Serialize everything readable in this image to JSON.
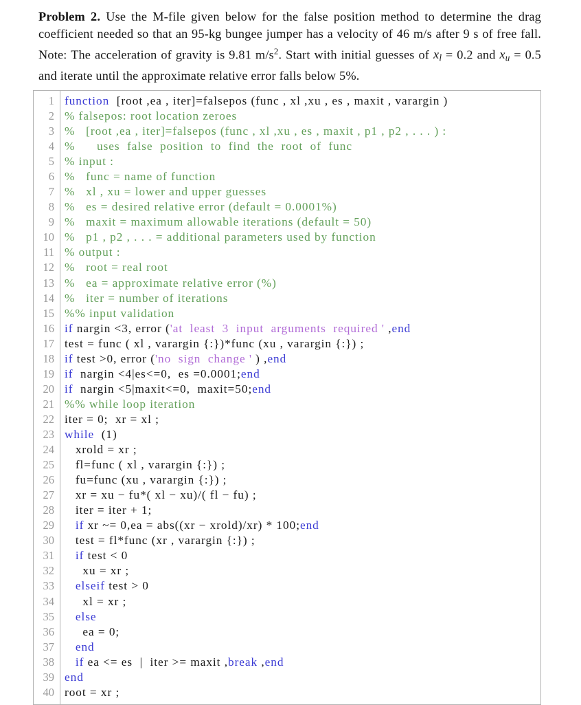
{
  "document": {
    "problem": {
      "label": "Problem 2.",
      "text_parts": {
        "p1": " Use the M-file given below for the false position method to determine the drag coefficient needed so that an 95-kg bungee jumper has a velocity of 46 m/s after 9 s of free fall. Note: The acceleration of gravity is 9.81 m/s",
        "sup1": "2",
        "p2": ". Start with initial guesses of ",
        "x_l": "x",
        "sub_l": "l",
        "p3": " = 0.2 and ",
        "x_u": "x",
        "sub_u": "u",
        "p4": " = 0.5 and iterate until the approximate relative error falls below 5%."
      },
      "plain_text": "Problem 2. Use the M-file given below for the false position method to determine the drag coefficient needed so that an 95-kg bungee jumper has a velocity of 46 m/s after 9 s of free fall. Note: The acceleration of gravity is 9.81 m/s^2. Start with initial guesses of x_l = 0.2 and x_u = 0.5 and iterate until the approximate relative error falls below 5%."
    },
    "colors": {
      "keyword": "#3b3bd4",
      "comment": "#63a05a",
      "string": "#b06ad6",
      "plain": "#1a1a1a",
      "lineno": "#9a9a9a",
      "border": "#b3b3b3",
      "background": "#ffffff"
    },
    "listing": {
      "language": "MATLAB",
      "first_line_number": 1,
      "total_lines": 40,
      "lines": [
        {
          "n": "1",
          "tokens": [
            {
              "t": "function",
              "c": "kw"
            },
            {
              "t": "  [root ,ea , iter]=falsepos (func , xl ,xu , es , maxit , varargin )",
              "c": "pl"
            }
          ]
        },
        {
          "n": "2",
          "tokens": [
            {
              "t": "% falsepos: root location zeroes",
              "c": "cm"
            }
          ]
        },
        {
          "n": "3",
          "tokens": [
            {
              "t": "%   [root ,ea , iter]=falsepos (func , xl ,xu , es , maxit , p1 , p2 , . . . ) :",
              "c": "cm"
            }
          ]
        },
        {
          "n": "4",
          "tokens": [
            {
              "t": "%      uses  false  position  to  find  the  root  of  func",
              "c": "cm"
            }
          ]
        },
        {
          "n": "5",
          "tokens": [
            {
              "t": "% input :",
              "c": "cm"
            }
          ]
        },
        {
          "n": "6",
          "tokens": [
            {
              "t": "%   func = name of function",
              "c": "cm"
            }
          ]
        },
        {
          "n": "7",
          "tokens": [
            {
              "t": "%   xl , xu = lower and upper guesses",
              "c": "cm"
            }
          ]
        },
        {
          "n": "8",
          "tokens": [
            {
              "t": "%   es = desired relative error (default = 0.0001%)",
              "c": "cm"
            }
          ]
        },
        {
          "n": "9",
          "tokens": [
            {
              "t": "%   maxit = maximum allowable iterations (default = 50)",
              "c": "cm"
            }
          ]
        },
        {
          "n": "10",
          "tokens": [
            {
              "t": "%   p1 , p2 , . . . = additional parameters used by function",
              "c": "cm"
            }
          ]
        },
        {
          "n": "11",
          "tokens": [
            {
              "t": "% output :",
              "c": "cm"
            }
          ]
        },
        {
          "n": "12",
          "tokens": [
            {
              "t": "%   root = real root",
              "c": "cm"
            }
          ]
        },
        {
          "n": "13",
          "tokens": [
            {
              "t": "%   ea = approximate relative error (%)",
              "c": "cm"
            }
          ]
        },
        {
          "n": "14",
          "tokens": [
            {
              "t": "%   iter = number of iterations",
              "c": "cm"
            }
          ]
        },
        {
          "n": "15",
          "tokens": [
            {
              "t": "%% input validation",
              "c": "cm"
            }
          ]
        },
        {
          "n": "16",
          "tokens": [
            {
              "t": "if",
              "c": "kw"
            },
            {
              "t": " nargin <3, error (",
              "c": "pl"
            },
            {
              "t": "'at  least  3  input  arguments  required '",
              "c": "str"
            },
            {
              "t": " ,",
              "c": "pl"
            },
            {
              "t": "end",
              "c": "kw"
            }
          ]
        },
        {
          "n": "17",
          "tokens": [
            {
              "t": "test = func ( xl , varargin {:})*func (xu , varargin {:}) ;",
              "c": "pl"
            }
          ]
        },
        {
          "n": "18",
          "tokens": [
            {
              "t": "if",
              "c": "kw"
            },
            {
              "t": " test >0, error (",
              "c": "pl"
            },
            {
              "t": "'no  sign  change '",
              "c": "str"
            },
            {
              "t": " ) ,",
              "c": "pl"
            },
            {
              "t": "end",
              "c": "kw"
            }
          ]
        },
        {
          "n": "19",
          "tokens": [
            {
              "t": "if",
              "c": "kw"
            },
            {
              "t": "  nargin <4|es<=0,  es =0.0001;",
              "c": "pl"
            },
            {
              "t": "end",
              "c": "kw"
            }
          ]
        },
        {
          "n": "20",
          "tokens": [
            {
              "t": "if",
              "c": "kw"
            },
            {
              "t": "  nargin <5|maxit<=0,  maxit=50;",
              "c": "pl"
            },
            {
              "t": "end",
              "c": "kw"
            }
          ]
        },
        {
          "n": "21",
          "tokens": [
            {
              "t": "%% while loop iteration",
              "c": "cm"
            }
          ]
        },
        {
          "n": "22",
          "tokens": [
            {
              "t": "iter = 0;  xr = xl ;",
              "c": "pl"
            }
          ]
        },
        {
          "n": "23",
          "tokens": [
            {
              "t": "while",
              "c": "kw"
            },
            {
              "t": "  (1)",
              "c": "pl"
            }
          ]
        },
        {
          "n": "24",
          "tokens": [
            {
              "t": "   xrold = xr ;",
              "c": "pl"
            }
          ]
        },
        {
          "n": "25",
          "tokens": [
            {
              "t": "   fl=func ( xl , varargin {:}) ;",
              "c": "pl"
            }
          ]
        },
        {
          "n": "26",
          "tokens": [
            {
              "t": "   fu=func (xu , varargin {:}) ;",
              "c": "pl"
            }
          ]
        },
        {
          "n": "27",
          "tokens": [
            {
              "t": "   xr = xu − fu*( xl − xu)/( fl − fu) ;",
              "c": "pl"
            }
          ]
        },
        {
          "n": "28",
          "tokens": [
            {
              "t": "   iter = iter + 1;",
              "c": "pl"
            }
          ]
        },
        {
          "n": "29",
          "tokens": [
            {
              "t": "   ",
              "c": "pl"
            },
            {
              "t": "if",
              "c": "kw"
            },
            {
              "t": " xr ~= 0,ea = abs((xr − xrold)/xr) * 100;",
              "c": "pl"
            },
            {
              "t": "end",
              "c": "kw"
            }
          ]
        },
        {
          "n": "30",
          "tokens": [
            {
              "t": "   test = fl*func (xr , varargin {:}) ;",
              "c": "pl"
            }
          ]
        },
        {
          "n": "31",
          "tokens": [
            {
              "t": "   ",
              "c": "pl"
            },
            {
              "t": "if",
              "c": "kw"
            },
            {
              "t": " test < 0",
              "c": "pl"
            }
          ]
        },
        {
          "n": "32",
          "tokens": [
            {
              "t": "     xu = xr ;",
              "c": "pl"
            }
          ]
        },
        {
          "n": "33",
          "tokens": [
            {
              "t": "   ",
              "c": "pl"
            },
            {
              "t": "elseif",
              "c": "kw"
            },
            {
              "t": " test > 0",
              "c": "pl"
            }
          ]
        },
        {
          "n": "34",
          "tokens": [
            {
              "t": "     xl = xr ;",
              "c": "pl"
            }
          ]
        },
        {
          "n": "35",
          "tokens": [
            {
              "t": "   ",
              "c": "pl"
            },
            {
              "t": "else",
              "c": "kw"
            }
          ]
        },
        {
          "n": "36",
          "tokens": [
            {
              "t": "     ea = 0;",
              "c": "pl"
            }
          ]
        },
        {
          "n": "37",
          "tokens": [
            {
              "t": "   ",
              "c": "pl"
            },
            {
              "t": "end",
              "c": "kw"
            }
          ]
        },
        {
          "n": "38",
          "tokens": [
            {
              "t": "   ",
              "c": "pl"
            },
            {
              "t": "if",
              "c": "kw"
            },
            {
              "t": " ea <= es  |  iter >= maxit ,",
              "c": "pl"
            },
            {
              "t": "break",
              "c": "kw"
            },
            {
              "t": " ,",
              "c": "pl"
            },
            {
              "t": "end",
              "c": "kw"
            }
          ]
        },
        {
          "n": "39",
          "tokens": [
            {
              "t": "end",
              "c": "kw"
            }
          ]
        },
        {
          "n": "40",
          "tokens": [
            {
              "t": "root = xr ;",
              "c": "pl"
            }
          ]
        }
      ]
    }
  }
}
